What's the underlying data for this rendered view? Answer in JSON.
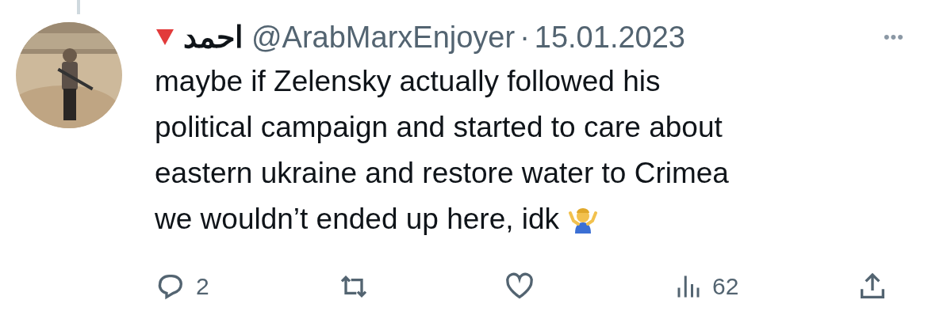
{
  "tweet": {
    "author_name": "احمد",
    "handle": "@ArabMarxEnjoyer",
    "separator": "·",
    "date": "15.01.2023",
    "more": "•••",
    "text_lines": [
      "maybe if Zelensky actually followed his",
      "political campaign and started to care about",
      "eastern ukraine and restore water to Crimea",
      "we wouldn’t ended up here, idk"
    ],
    "actions": [
      {
        "kind": "reply",
        "count": "2"
      },
      {
        "kind": "retweet"
      },
      {
        "kind": "like"
      },
      {
        "kind": "views",
        "count": "62"
      },
      {
        "kind": "share"
      }
    ]
  }
}
